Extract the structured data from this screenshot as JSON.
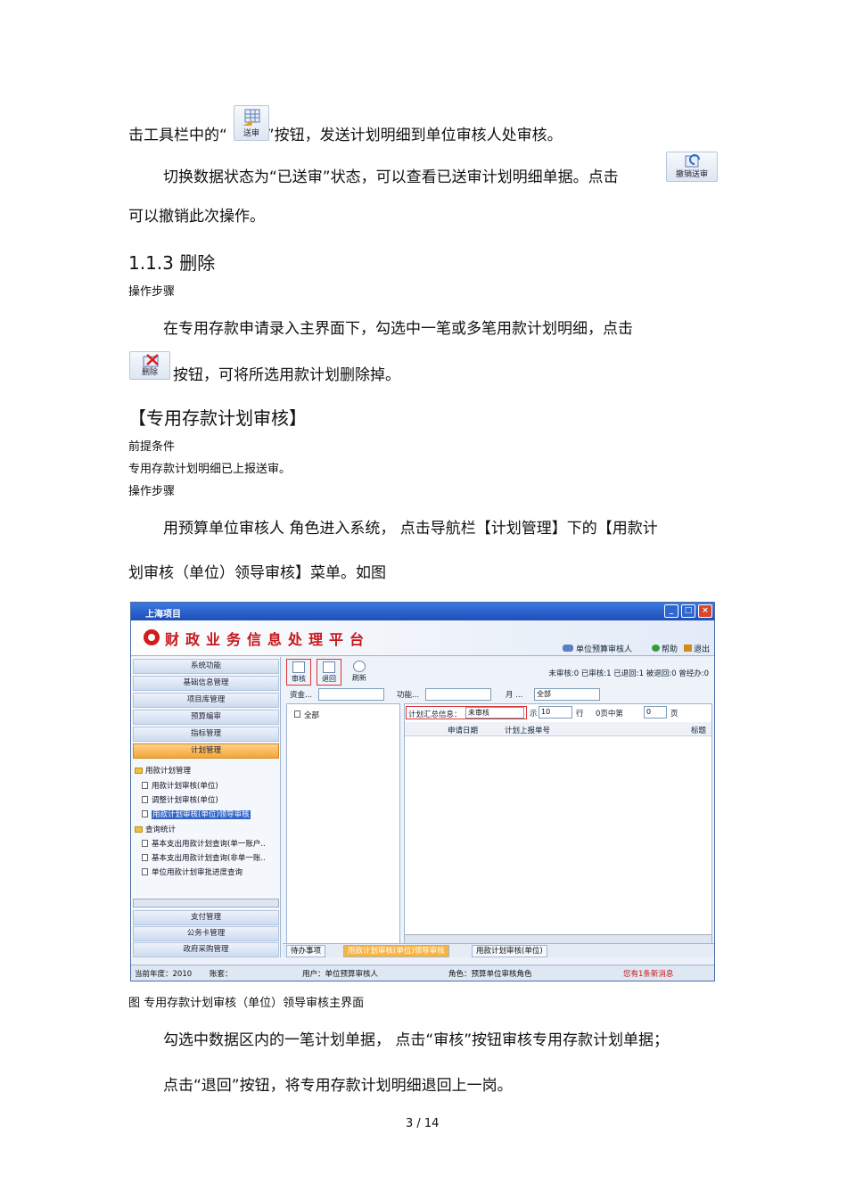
{
  "doc": {
    "p1_pre": "击工具栏中的“",
    "p1_post": "”按钮，发送计划明细到单位审核人处审核。",
    "btn_send": "送审",
    "p2": "切换数据状态为“已送审”状态，可以查看已送审计划明细单据。点击",
    "btn_revoke": "撤销送审",
    "p3": "可以撤销此次操作。",
    "h_delete": "1.1.3 删除",
    "steps1": "操作步骤",
    "p4": "在专用存款申请录入主界面下，勾选中一笔或多笔用款计划明细，点击",
    "btn_delete": "删除",
    "p5": "按钮，可将所选用款计划删除掉。",
    "h_audit": "【专用存款计划审核】",
    "precond": "前提条件",
    "precond_text": "专用存款计划明细已上报送审。",
    "steps2": "操作步骤",
    "p6": "用预算单位审核人  角色进入系统，    点击导航栏【计划管理】下的【用款计",
    "p7": "划审核（单位）领导审核】菜单。如图",
    "caption": "图     专用存款计划审核（单位）领导审核主界面",
    "p8": "勾选中数据区内的一笔计划单据，    点击“审核”按钮审核专用存款计划单据；",
    "p9": "点击“退回”按钮，将专用存款计划明细退回上一岗。",
    "page_num": "3 / 14"
  },
  "app": {
    "window_title": "上海项目",
    "brand": "财政业务信息处理平台",
    "nav_right": [
      "单位预算审核人",
      "帮助",
      "退出"
    ],
    "left_menu": [
      "系统功能",
      "基础信息管理",
      "项目库管理",
      "预算编审",
      "指标管理",
      "计划管理"
    ],
    "tree": {
      "group1": "用款计划管理",
      "group1_items": [
        "用款计划审核(单位)",
        "调整计划审核(单位)",
        "用款计划审核(单位)领导审核"
      ],
      "group2": "查询统计",
      "group2_items": [
        "基本支出用款计划查询(单一账户..",
        "基本支出用款计划查询(非单一账..",
        "单位用款计划审批进度查询"
      ]
    },
    "left_menu_bottom": [
      "支付管理",
      "公务卡管理",
      "政府采购管理"
    ],
    "toolbar": [
      "审核",
      "退回",
      "刷新"
    ],
    "counts": "未审核:0  已审核:1  已退回:1  被退回:0  曾经办:0",
    "filter": {
      "fund_label": "资金...",
      "func_label": "功能...",
      "month_label": "月  ...",
      "month_value": "全部"
    },
    "tree_all": "全部",
    "summary_label": "计划汇总信息：",
    "summary_value": "未审核",
    "pager": {
      "show_label": "示",
      "rows": "10",
      "row_label": "行",
      "page_text": "0页中第",
      "page_value": "0",
      "page_label": "页"
    },
    "grid_headers": [
      "申请日期",
      "计划上报单号",
      "标题"
    ],
    "tabs": [
      "待办事项",
      "用款计划审核(单位)领导审核",
      "用款计划审核(单位)"
    ],
    "status": {
      "year": "当前年度：2010",
      "account": "账套：",
      "user": "用户：单位预算审核人",
      "role": "角色：预算单位审核角色",
      "msg": "您有1条新消息"
    }
  }
}
